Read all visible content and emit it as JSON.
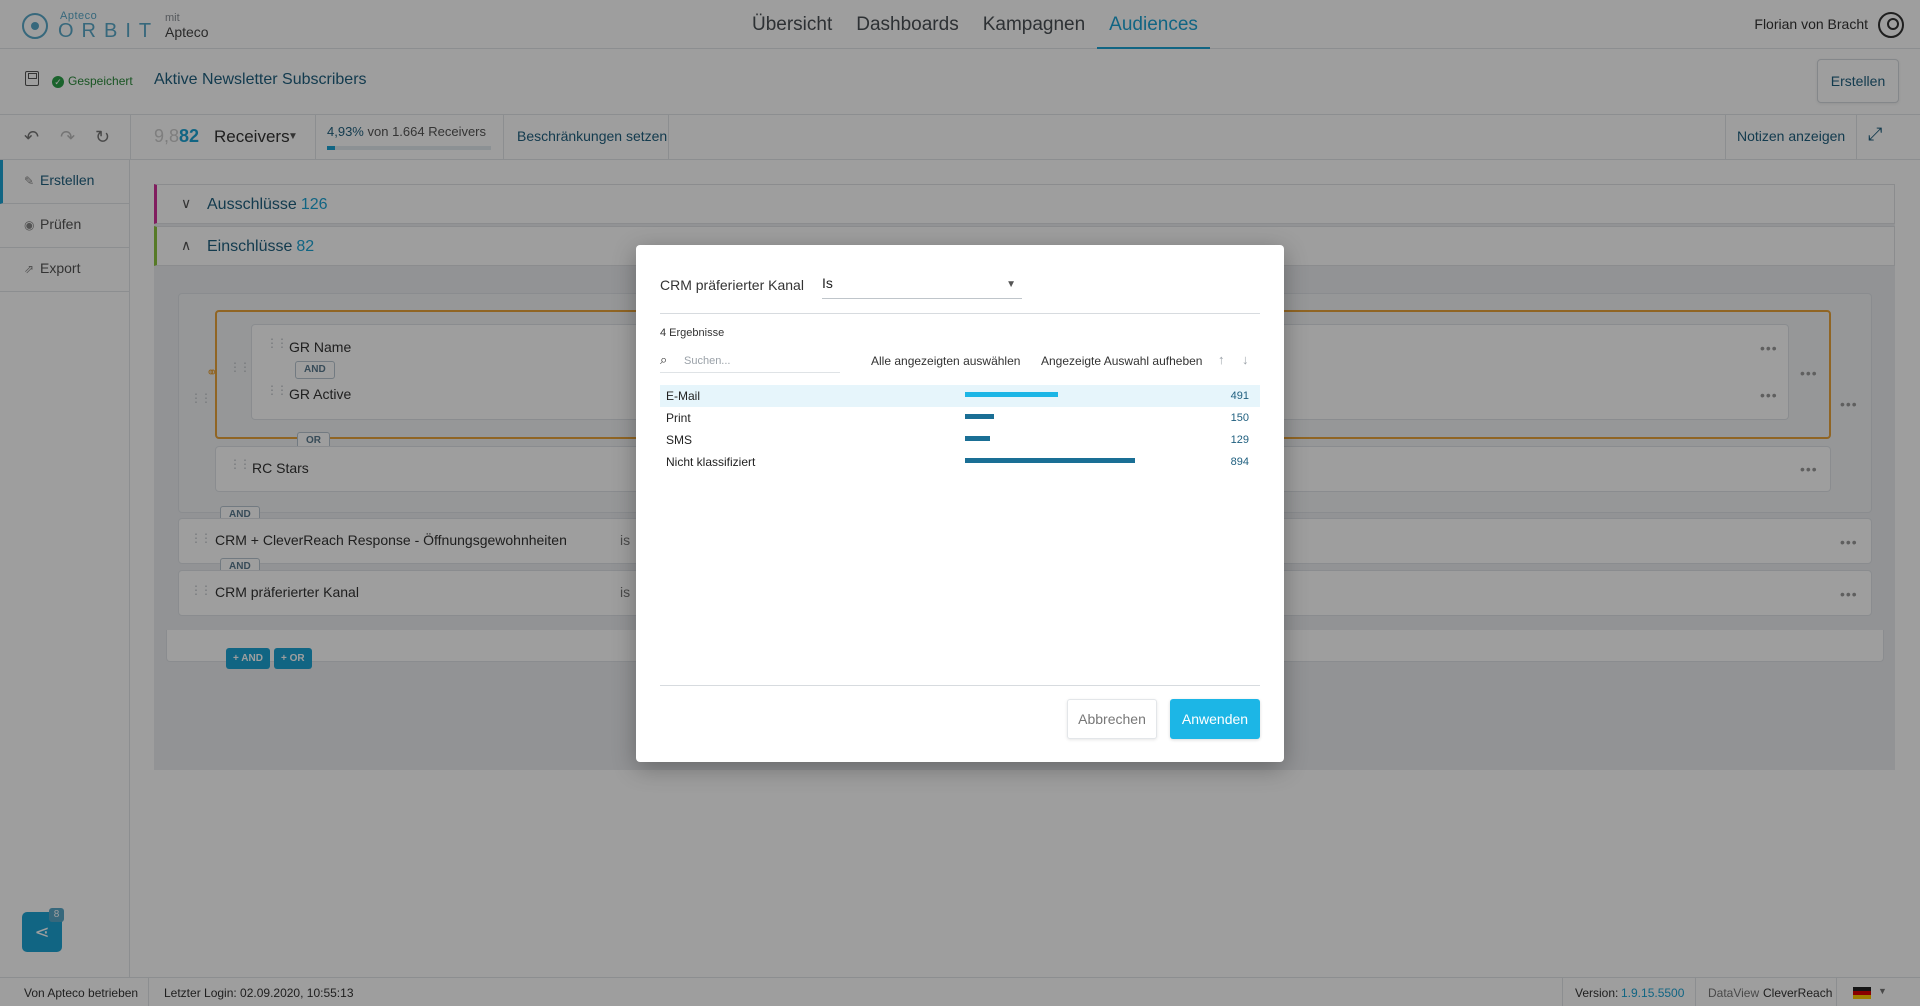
{
  "header": {
    "brand_small": "Apteco",
    "brand_big": "ORBIT",
    "mit_label": "mit",
    "mit_brand": "Apteco",
    "nav": [
      "Übersicht",
      "Dashboards",
      "Kampagnen",
      "Audiences"
    ],
    "active_nav": "Audiences",
    "user_name": "Florian von Bracht"
  },
  "audience": {
    "saved_label": "Gespeichert",
    "title": "Aktive Newsletter Subscribers",
    "create_button": "Erstellen"
  },
  "toolbar": {
    "count_faded": "9,8",
    "count": "82",
    "unit": "Receivers",
    "percent": "4,93%",
    "percent_rest": "von 1.664 Receivers",
    "percent_value": 4.93,
    "limits_label": "Beschränkungen setzen",
    "notes_label": "Notizen anzeigen"
  },
  "sidebar": {
    "items": [
      {
        "label": "Erstellen",
        "icon": "edit-icon"
      },
      {
        "label": "Prüfen",
        "icon": "eye-icon"
      },
      {
        "label": "Export",
        "icon": "export-icon"
      }
    ],
    "share_badge": "8"
  },
  "builder": {
    "exclusions_label": "Ausschlüsse",
    "exclusions_count": "126",
    "inclusions_label": "Einschlüsse",
    "inclusions_count": "82",
    "rules": {
      "gr_name": "GR Name",
      "gr_active": "GR Active",
      "rc_stars": "RC Stars",
      "crm_clever": "CRM + CleverReach Response - Öffnungsgewohnheiten",
      "crm_kanal": "CRM präferierter Kanal",
      "is_text": "is"
    },
    "tags": {
      "and": "AND",
      "or": "OR"
    },
    "add_and": "+ AND",
    "add_or": "+ OR"
  },
  "modal": {
    "field_label": "CRM präferierter Kanal",
    "operator": "Is",
    "results_label": "4 Ergebnisse",
    "search_placeholder": "Suchen...",
    "select_all": "Alle angezeigten auswählen",
    "deselect": "Angezeigte Auswahl aufheben",
    "sort_up": "↑",
    "sort_down": "↓",
    "items": [
      {
        "label": "E-Mail",
        "count": "491",
        "value": 491,
        "highlighted": true
      },
      {
        "label": "Print",
        "count": "150",
        "value": 150,
        "highlighted": false
      },
      {
        "label": "SMS",
        "count": "129",
        "value": 129,
        "highlighted": false
      },
      {
        "label": "Nicht klassifiziert",
        "count": "894",
        "value": 894,
        "highlighted": false
      }
    ],
    "cancel": "Abbrechen",
    "apply": "Anwenden"
  },
  "status": {
    "operated_by": "Von Apteco betrieben",
    "last_login": "Letzter Login: 02.09.2020, 10:55:13",
    "version_label": "Version:",
    "version": "1.9.15.5500",
    "dataview_label": "DataView",
    "dataview": "CleverReach"
  },
  "colors": {
    "accent": "#1ca3d4",
    "exclusion": "#d0309a",
    "inclusion": "#8cc63f",
    "or_group": "#e8a33a"
  }
}
